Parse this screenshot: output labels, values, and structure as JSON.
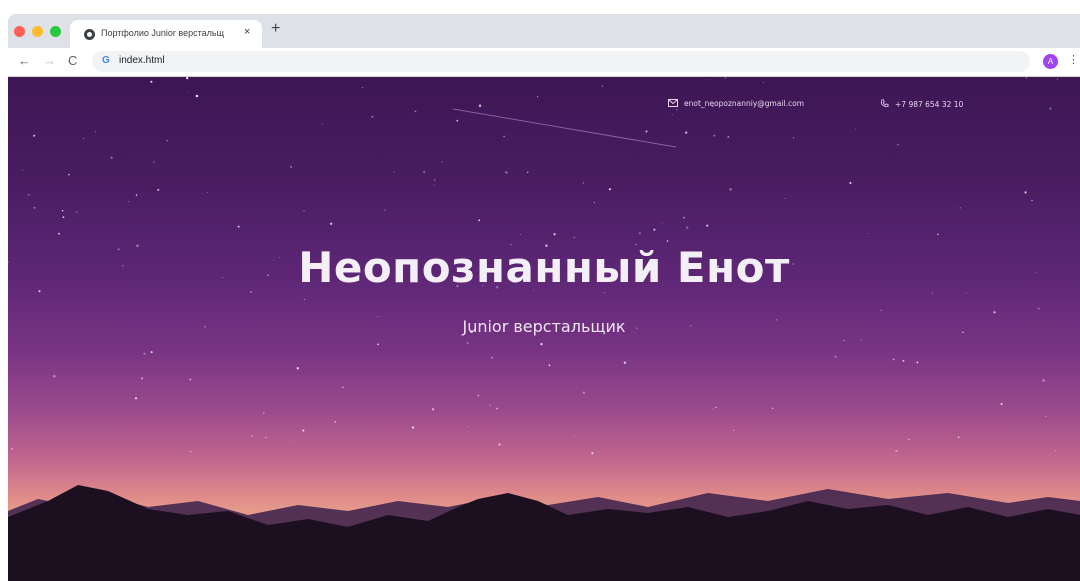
{
  "browser": {
    "tab_title": "Портфолио Junior верстальщ",
    "tab_close": "×",
    "new_tab": "+",
    "url": "index.html",
    "url_icon": "G",
    "profile_initial": "A"
  },
  "page": {
    "email": "enot_neopoznanniy@gmail.com",
    "phone": "+7 987 654 32 10",
    "title": "Неопознанный Енот",
    "subtitle": "Junior верстальщик"
  },
  "colors": {
    "sky_top": "#3d1654",
    "horizon": "#e9a48a",
    "mountains": "#1c0f20"
  }
}
